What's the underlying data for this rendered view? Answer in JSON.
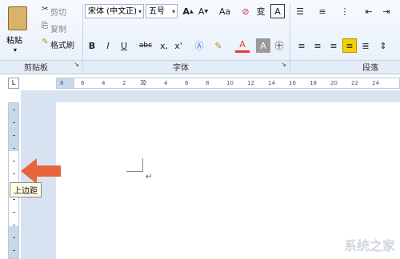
{
  "clipboard": {
    "paste_label": "粘贴",
    "cut_label": "剪切",
    "copy_label": "复制",
    "format_painter_label": "格式刷",
    "group_label": "剪贴板"
  },
  "font": {
    "font_name": "宋体 (中文正)",
    "font_size": "五号",
    "group_label": "字体",
    "aa_label": "Aa",
    "phonetic_label": "变",
    "border_label": "A",
    "case_label": "A",
    "bold": "B",
    "italic": "I",
    "underline": "U",
    "strike": "abc",
    "subscript": "x,",
    "superscript": "x'",
    "font_color": "A",
    "shade": "A",
    "enclose": "字"
  },
  "paragraph": {
    "group_label": "段落"
  },
  "ruler": {
    "h_labels": [
      "8",
      "6",
      "4",
      "2",
      "2",
      "4",
      "6",
      "8",
      "10",
      "12",
      "14",
      "16",
      "18",
      "20",
      "22",
      "24"
    ],
    "tab_stop": "L"
  },
  "document": {
    "paragraph_mark": "↵"
  },
  "tooltip": {
    "text": "上边距"
  },
  "watermark": {
    "text": "系统之家"
  },
  "colors": {
    "arrow": "#e8643c",
    "ribbon_bg": "#e6eef8",
    "font_color_bar": "#e53935",
    "highlight": "#f5d100"
  }
}
